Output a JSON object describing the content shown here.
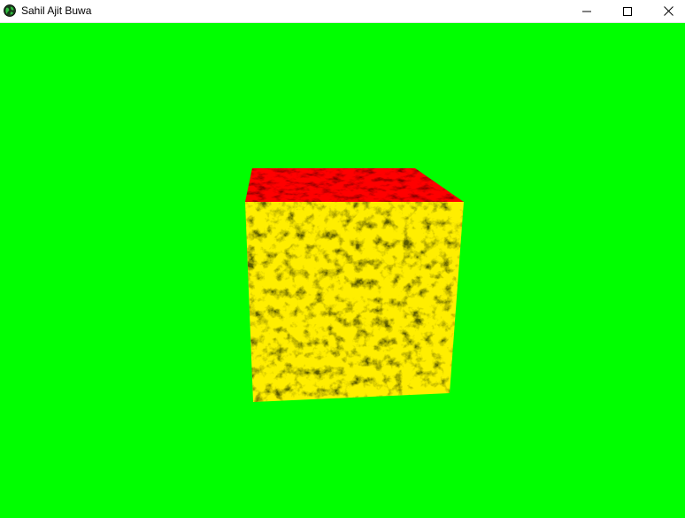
{
  "window": {
    "title": "Sahil Ajit Buwa",
    "app_icon": "globe-icon",
    "controls": {
      "minimize_icon": "minimize-icon",
      "maximize_icon": "maximize-icon",
      "close_icon": "close-icon"
    }
  },
  "scene": {
    "background_color": "#00ff00",
    "object": "textured-cube",
    "front_face_color": "#ffee00",
    "top_face_color": "#ff0000"
  }
}
